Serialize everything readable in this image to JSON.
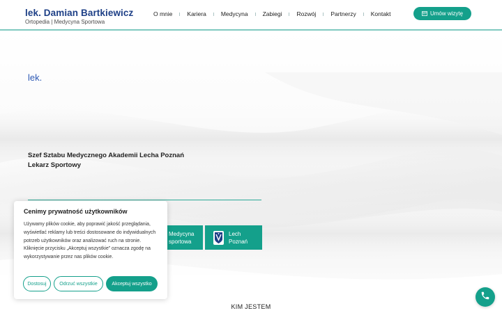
{
  "header": {
    "brand_name": "lek. Damian Bartkiewicz",
    "brand_subtitle": "Ortopedia | Medycyna Sportowa",
    "nav": [
      "O mnie",
      "Kariera",
      "Medycyna",
      "Zabiegi",
      "Rozwój",
      "Partnerzy",
      "Kontakt"
    ],
    "cta_label": "Umów wizytę",
    "cta_icon": "calendar-icon"
  },
  "hero": {
    "prefix": "lek.",
    "role_line_1": "Szef Sztabu Medycznego Akademii Lecha Poznań",
    "role_line_2": "Lekarz Sportowy",
    "tiles": [
      {
        "line1": "Medycyna",
        "line2": "sportowa"
      },
      {
        "line1": "Lech",
        "line2": "Poznań",
        "icon": "lech-poznan-crest-icon"
      }
    ]
  },
  "section": {
    "title": "KIM JESTEM"
  },
  "cookie": {
    "title": "Cenimy prywatność użytkowników",
    "text": "Używamy plików cookie, aby poprawić jakość przeglądania, wyświetlać reklamy lub treści dostosowane do indywidualnych potrzeb użytkowników oraz analizować ruch na stronie. Kliknięcie przycisku „Akceptuj wszystkie” oznacza zgodę na wykorzystywanie przez nas plików cookie.",
    "btn_customize": "Dostosuj",
    "btn_reject": "Odrzuć wszystkie",
    "btn_accept": "Akceptuj wszystko"
  },
  "floating": {
    "phone_icon": "phone-icon"
  },
  "colors": {
    "accent": "#14a08b",
    "brand_blue": "#1d3f86",
    "prefix_blue": "#2c58b4"
  }
}
